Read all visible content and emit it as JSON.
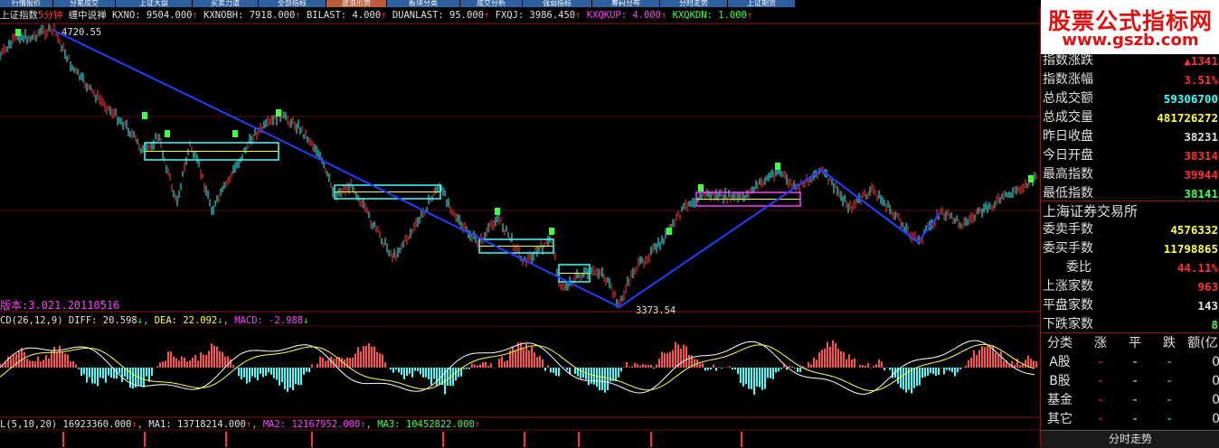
{
  "tabs": [
    "行情报价",
    "分笔成交",
    "上证大盘",
    "买卖力道",
    "全部指标",
    "波浪形势",
    "板块分类",
    "成交分析",
    "强弱指标",
    "筹码分布",
    "分时走势",
    "上证期货"
  ],
  "info": {
    "title": "上证指数",
    "period": "5分钟",
    "indicator": "缠中说禅",
    "kxno": "KXNO: 9504.000",
    "kxnobh": "KXNOBH: 7918.000",
    "bilast": "BILAST: 4.000",
    "duanlast": "DUANLAST: 95.000",
    "fxqj": "FXQJ: 3986.450",
    "kxqkup": "KXQKUP: 4.000",
    "kxqkdn": "KXQKDN: 1.000",
    "arrow": "↑"
  },
  "price_high_label": "4720.55",
  "price_low_label": "3373.54",
  "version": "版本:3.021.20110516",
  "macd": {
    "name": "CD(26,12,9)",
    "diff": "DIFF: 20.598",
    "dea": "DEA: 22.092",
    "macd": "MACD: -2.988",
    "arrow_down": "↓"
  },
  "vol": {
    "name": "L(5,10,20)",
    "v": "16923360.000",
    "ma1": "MA1: 13718214.000",
    "ma2": "MA2: 12167952.000",
    "ma3": "MA3: 10452822.000",
    "arrow": "↑"
  },
  "logo": {
    "text": "股票公式指标网",
    "url": "www.gszb.com"
  },
  "stats": [
    {
      "label": "指数涨跌",
      "value": "▲1341",
      "color": "#ff3030"
    },
    {
      "label": "指数涨幅",
      "value": "3.51%",
      "color": "#ff3030"
    },
    {
      "label": "总成交额",
      "value": "59306700",
      "color": "#40ffff"
    },
    {
      "label": "总成交量",
      "value": "481726272",
      "color": "#ffff40"
    },
    {
      "label": "昨日收盘",
      "value": "38231",
      "color": "#e0e0e0"
    },
    {
      "label": "今日开盘",
      "value": "38314",
      "color": "#ff3030"
    },
    {
      "label": "最高指数",
      "value": "39944",
      "color": "#ff3030"
    },
    {
      "label": "最低指数",
      "value": "38141",
      "color": "#40ff40"
    }
  ],
  "exchange": "上海证券交易所",
  "trade_stats": [
    {
      "label": "委卖手数",
      "value": "4576332",
      "color": "#ffff40"
    },
    {
      "label": "委买手数",
      "value": "11798865",
      "color": "#ffff40"
    },
    {
      "label": "委比",
      "value": "44.11%",
      "color": "#ff3030"
    },
    {
      "label": "上涨家数",
      "value": "963",
      "color": "#ff3030"
    },
    {
      "label": "平盘家数",
      "value": "143",
      "color": "#e0e0e0"
    },
    {
      "label": "下跌家数",
      "value": "8",
      "color": "#40ff40"
    }
  ],
  "table": {
    "headers": [
      "分类",
      "涨",
      "平",
      "跌",
      "额(亿"
    ],
    "rows": [
      {
        "name": "A股",
        "vals": [
          "-",
          "-",
          "-",
          "0"
        ]
      },
      {
        "name": "B股",
        "vals": [
          "-",
          "-",
          "-",
          "0"
        ]
      },
      {
        "name": "基金",
        "vals": [
          "-",
          "-",
          "-",
          "0"
        ]
      },
      {
        "name": "其它",
        "vals": [
          "-",
          "-",
          "-",
          "0"
        ]
      }
    ]
  },
  "bottom_button": "分时走势"
}
